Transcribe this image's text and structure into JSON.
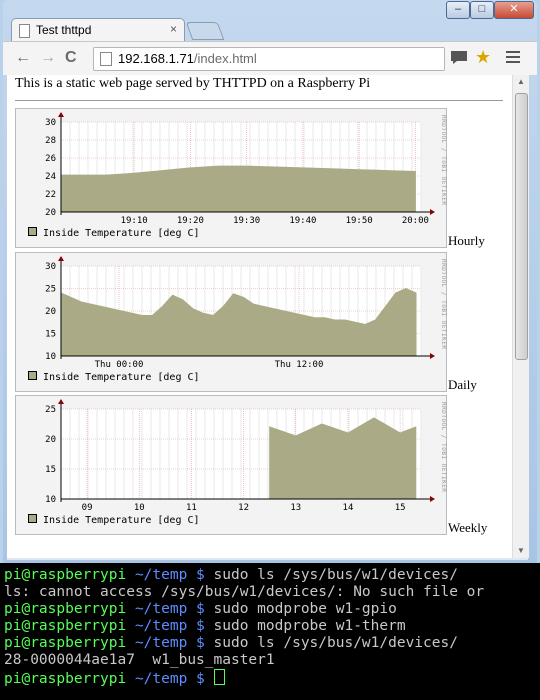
{
  "browser": {
    "tab_title": "Test thttpd",
    "tab_close_glyph": "×",
    "url_host": "192.168.1.71",
    "url_path": "/index.html",
    "window_controls": [
      "–",
      "□",
      "✕"
    ],
    "nav_back": "←",
    "nav_forward": "→",
    "nav_reload": "C"
  },
  "page": {
    "intro": "This is a static web page served by THTTPD on a Raspberry Pi",
    "credit": "RRDTOOL / TOBI OETIKER",
    "graphs": [
      {
        "caption": "Hourly",
        "legend": "Inside Temperature [deg C]"
      },
      {
        "caption": "Daily",
        "legend": "Inside Temperature [deg C]"
      },
      {
        "caption": "Weekly",
        "legend": "Inside Temperature [deg C]"
      }
    ]
  },
  "chart_data": [
    {
      "type": "area",
      "title": "",
      "series": [
        {
          "name": "Inside Temperature [deg C]",
          "x": [
            "19:05",
            "19:10",
            "19:15",
            "19:20",
            "19:25",
            "19:30",
            "19:35",
            "19:40",
            "19:45",
            "19:50",
            "19:55",
            "20:00"
          ],
          "values": [
            24.1,
            24.3,
            24.6,
            24.9,
            25.1,
            25.1,
            25.0,
            24.9,
            24.8,
            24.7,
            24.6,
            24.5
          ]
        }
      ],
      "xticks": [
        "19:10",
        "19:20",
        "19:30",
        "19:40",
        "19:50",
        "20:00"
      ],
      "yticks": [
        20,
        22,
        24,
        26,
        28,
        30
      ],
      "ylim": [
        20,
        30
      ],
      "color": "#aaaa86"
    },
    {
      "type": "area",
      "title": "",
      "series": [
        {
          "name": "Inside Temperature [deg C]",
          "values": [
            24,
            23,
            22,
            21.5,
            21,
            20.5,
            20,
            19.5,
            19,
            19,
            21,
            23.5,
            22.5,
            20.5,
            19.5,
            19,
            21,
            23.8,
            23,
            21.5,
            21,
            20.5,
            20,
            19.5,
            19,
            18.5,
            18.5,
            18,
            18,
            17.5,
            17,
            18,
            21,
            24,
            25,
            24
          ]
        }
      ],
      "xticks": [
        "Thu 00:00",
        "Thu 12:00"
      ],
      "yticks": [
        10,
        15,
        20,
        25,
        30
      ],
      "ylim": [
        10,
        30
      ],
      "color": "#aaaa86"
    },
    {
      "type": "area",
      "title": "",
      "series": [
        {
          "name": "Inside Temperature [deg C]",
          "x": [
            "12.5",
            "13",
            "13.5",
            "14",
            "14.5",
            "15",
            "15.3"
          ],
          "values": [
            22,
            20.5,
            22.5,
            21,
            23.5,
            21,
            22
          ]
        }
      ],
      "xticks": [
        "09",
        "10",
        "11",
        "12",
        "13",
        "14",
        "15"
      ],
      "yticks": [
        10,
        15,
        20,
        25
      ],
      "ylim": [
        10,
        25
      ],
      "color": "#aaaa86"
    }
  ],
  "terminal": {
    "prompt_host": "pi@raspberrypi",
    "prompt_path": "~/temp $",
    "lines": [
      {
        "type": "cmd",
        "text": " sudo ls /sys/bus/w1/devices/"
      },
      {
        "type": "out",
        "text": "ls: cannot access /sys/bus/w1/devices/: No such file or"
      },
      {
        "type": "cmd",
        "text": " sudo modprobe w1-gpio"
      },
      {
        "type": "cmd",
        "text": " sudo modprobe w1-therm"
      },
      {
        "type": "cmd",
        "text": " sudo ls /sys/bus/w1/devices/"
      },
      {
        "type": "out",
        "text": "28-0000044ae1a7  w1_bus_master1"
      },
      {
        "type": "cmd",
        "text": " "
      }
    ]
  }
}
